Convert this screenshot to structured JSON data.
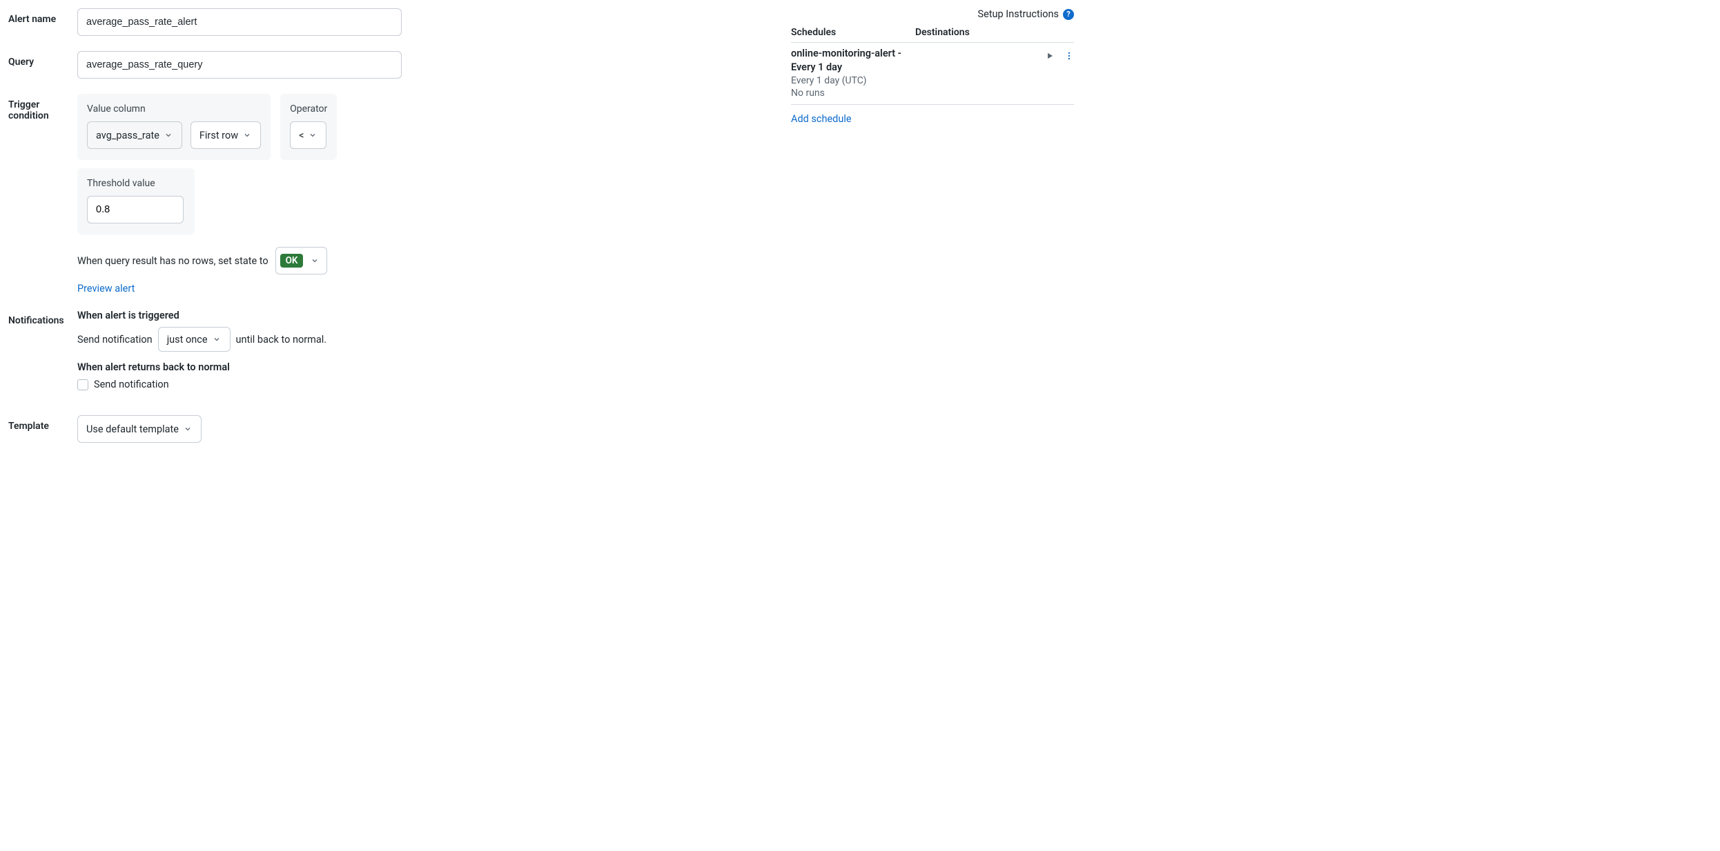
{
  "form": {
    "alert_name": {
      "label": "Alert name",
      "value": "average_pass_rate_alert"
    },
    "query": {
      "label": "Query",
      "value": "average_pass_rate_query"
    },
    "trigger": {
      "label": "Trigger condition",
      "value_column_label": "Value column",
      "value_column_value": "avg_pass_rate",
      "row_selector": "First row",
      "operator_label": "Operator",
      "operator_value": "<",
      "threshold_label": "Threshold value",
      "threshold_value": "0.8",
      "no_rows_text": "When query result has no rows, set state to",
      "no_rows_state": "OK",
      "preview_link": "Preview alert"
    },
    "notifications": {
      "label": "Notifications",
      "triggered_heading": "When alert is triggered",
      "send_prefix": "Send notification",
      "frequency": "just once",
      "send_suffix": "until back to normal.",
      "normal_heading": "When alert returns back to normal",
      "normal_checkbox_label": "Send notification"
    },
    "template": {
      "label": "Template",
      "value": "Use default template"
    }
  },
  "right": {
    "setup_link": "Setup Instructions",
    "columns": {
      "schedules": "Schedules",
      "destinations": "Destinations"
    },
    "schedule": {
      "title": "online-monitoring-alert - Every 1 day",
      "interval": "Every 1 day (UTC)",
      "runs": "No runs"
    },
    "add_schedule": "Add schedule"
  }
}
